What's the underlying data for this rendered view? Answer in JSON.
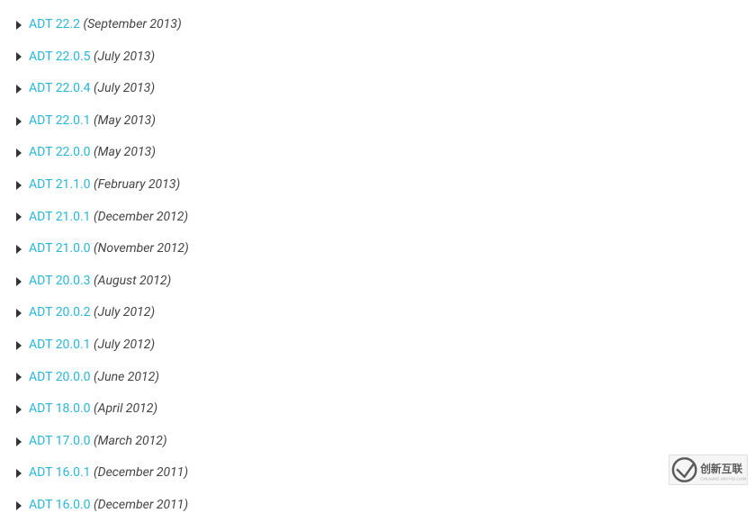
{
  "versions": [
    {
      "name": "ADT 22.2",
      "date": "(September 2013)"
    },
    {
      "name": "ADT 22.0.5",
      "date": "(July 2013)"
    },
    {
      "name": "ADT 22.0.4",
      "date": "(July 2013)"
    },
    {
      "name": "ADT 22.0.1",
      "date": "(May 2013)"
    },
    {
      "name": "ADT 22.0.0",
      "date": "(May 2013)"
    },
    {
      "name": "ADT 21.1.0",
      "date": "(February 2013)"
    },
    {
      "name": "ADT 21.0.1",
      "date": "(December 2012)"
    },
    {
      "name": "ADT 21.0.0",
      "date": "(November 2012)"
    },
    {
      "name": "ADT 20.0.3",
      "date": "(August 2012)"
    },
    {
      "name": "ADT 20.0.2",
      "date": "(July 2012)"
    },
    {
      "name": "ADT 20.0.1",
      "date": "(July 2012)"
    },
    {
      "name": "ADT 20.0.0",
      "date": "(June 2012)"
    },
    {
      "name": "ADT 18.0.0",
      "date": "(April 2012)"
    },
    {
      "name": "ADT 17.0.0",
      "date": "(March 2012)"
    },
    {
      "name": "ADT 16.0.1",
      "date": "(December 2011)"
    },
    {
      "name": "ADT 16.0.0",
      "date": "(December 2011)"
    }
  ],
  "watermark_text": "创新互联"
}
